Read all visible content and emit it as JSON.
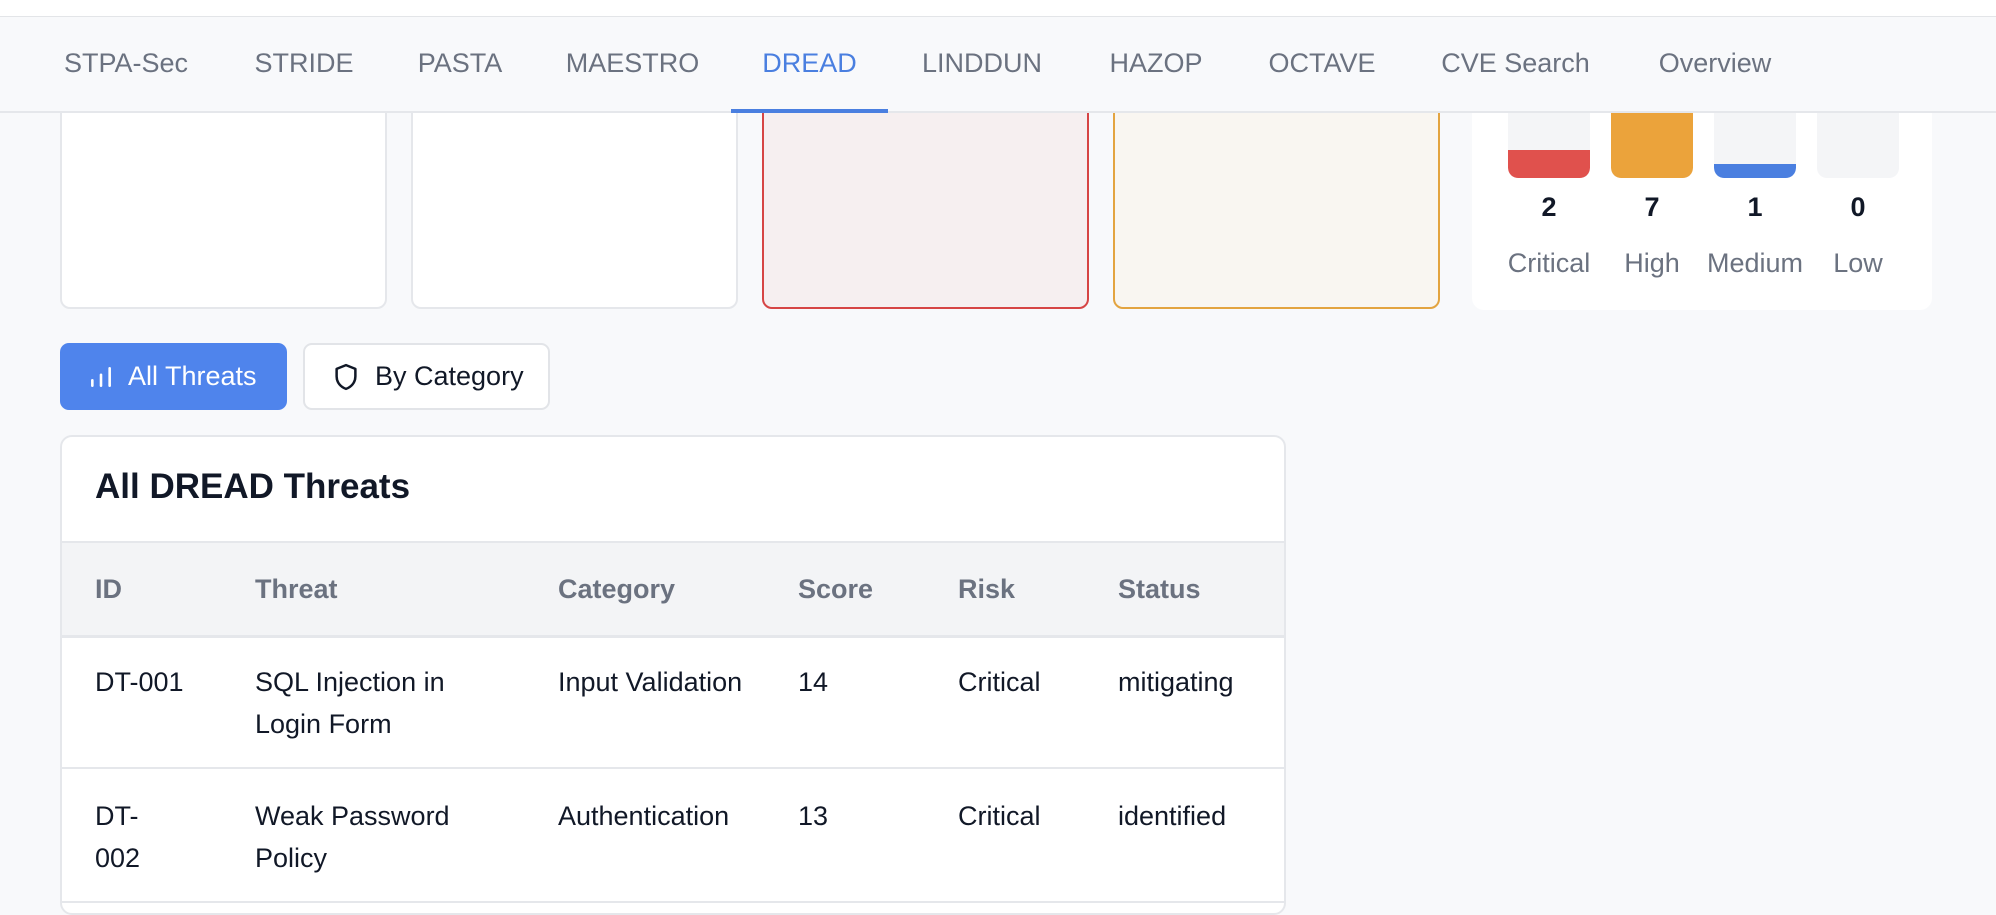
{
  "nav": {
    "tabs": [
      {
        "label": "STPA-Sec"
      },
      {
        "label": "STRIDE"
      },
      {
        "label": "PASTA"
      },
      {
        "label": "MAESTRO"
      },
      {
        "label": "DREAD"
      },
      {
        "label": "LINDDUN"
      },
      {
        "label": "HAZOP"
      },
      {
        "label": "OCTAVE"
      },
      {
        "label": "CVE Search"
      },
      {
        "label": "Overview"
      }
    ],
    "active": "DREAD",
    "accent_color": "#4a7fe0"
  },
  "risk_summary": {
    "levels": [
      {
        "label": "Critical",
        "count": "2",
        "fill_fraction": 0.29,
        "color": "#e0514d"
      },
      {
        "label": "High",
        "count": "7",
        "fill_fraction": 1.0,
        "color": "#eba33b"
      },
      {
        "label": "Medium",
        "count": "1",
        "fill_fraction": 0.14,
        "color": "#4a7fe0"
      },
      {
        "label": "Low",
        "count": "0",
        "fill_fraction": 0,
        "color": "#d1d5db"
      }
    ]
  },
  "view_toggle": {
    "all_label": "All Threats",
    "all_icon": "bar-chart-icon",
    "category_label": "By Category",
    "category_icon": "shield-icon"
  },
  "threats_table": {
    "title": "All DREAD Threats",
    "headers": {
      "id": "ID",
      "threat": "Threat",
      "category": "Category",
      "score": "Score",
      "risk": "Risk",
      "status": "Status"
    },
    "rows": [
      {
        "id": "DT-001",
        "threat": "SQL Injection in Login Form",
        "category": "Input Validation",
        "score": "14",
        "risk": "Critical",
        "status": "mitigating"
      },
      {
        "id": "DT-002",
        "threat": "Weak Password Policy",
        "category": "Authentication",
        "score": "13",
        "risk": "Critical",
        "status": "identified"
      }
    ]
  }
}
